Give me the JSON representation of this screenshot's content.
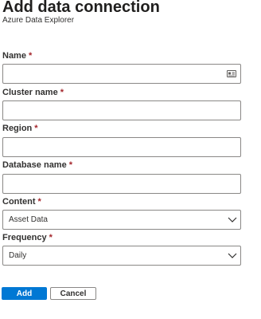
{
  "header": {
    "title": "Add data connection",
    "subtitle": "Azure Data Explorer"
  },
  "required_marker": "*",
  "form": {
    "name": {
      "label": "Name",
      "value": "",
      "icon": "id-card-icon"
    },
    "cluster_name": {
      "label": "Cluster name",
      "value": ""
    },
    "region": {
      "label": "Region",
      "value": ""
    },
    "database_name": {
      "label": "Database name",
      "value": ""
    },
    "content": {
      "label": "Content",
      "selected": "Asset Data"
    },
    "frequency": {
      "label": "Frequency",
      "selected": "Daily"
    }
  },
  "actions": {
    "add_label": "Add",
    "cancel_label": "Cancel"
  },
  "colors": {
    "accent": "#0078d4",
    "required": "#a4262c",
    "border": "#8a8886",
    "text": "#323130"
  }
}
